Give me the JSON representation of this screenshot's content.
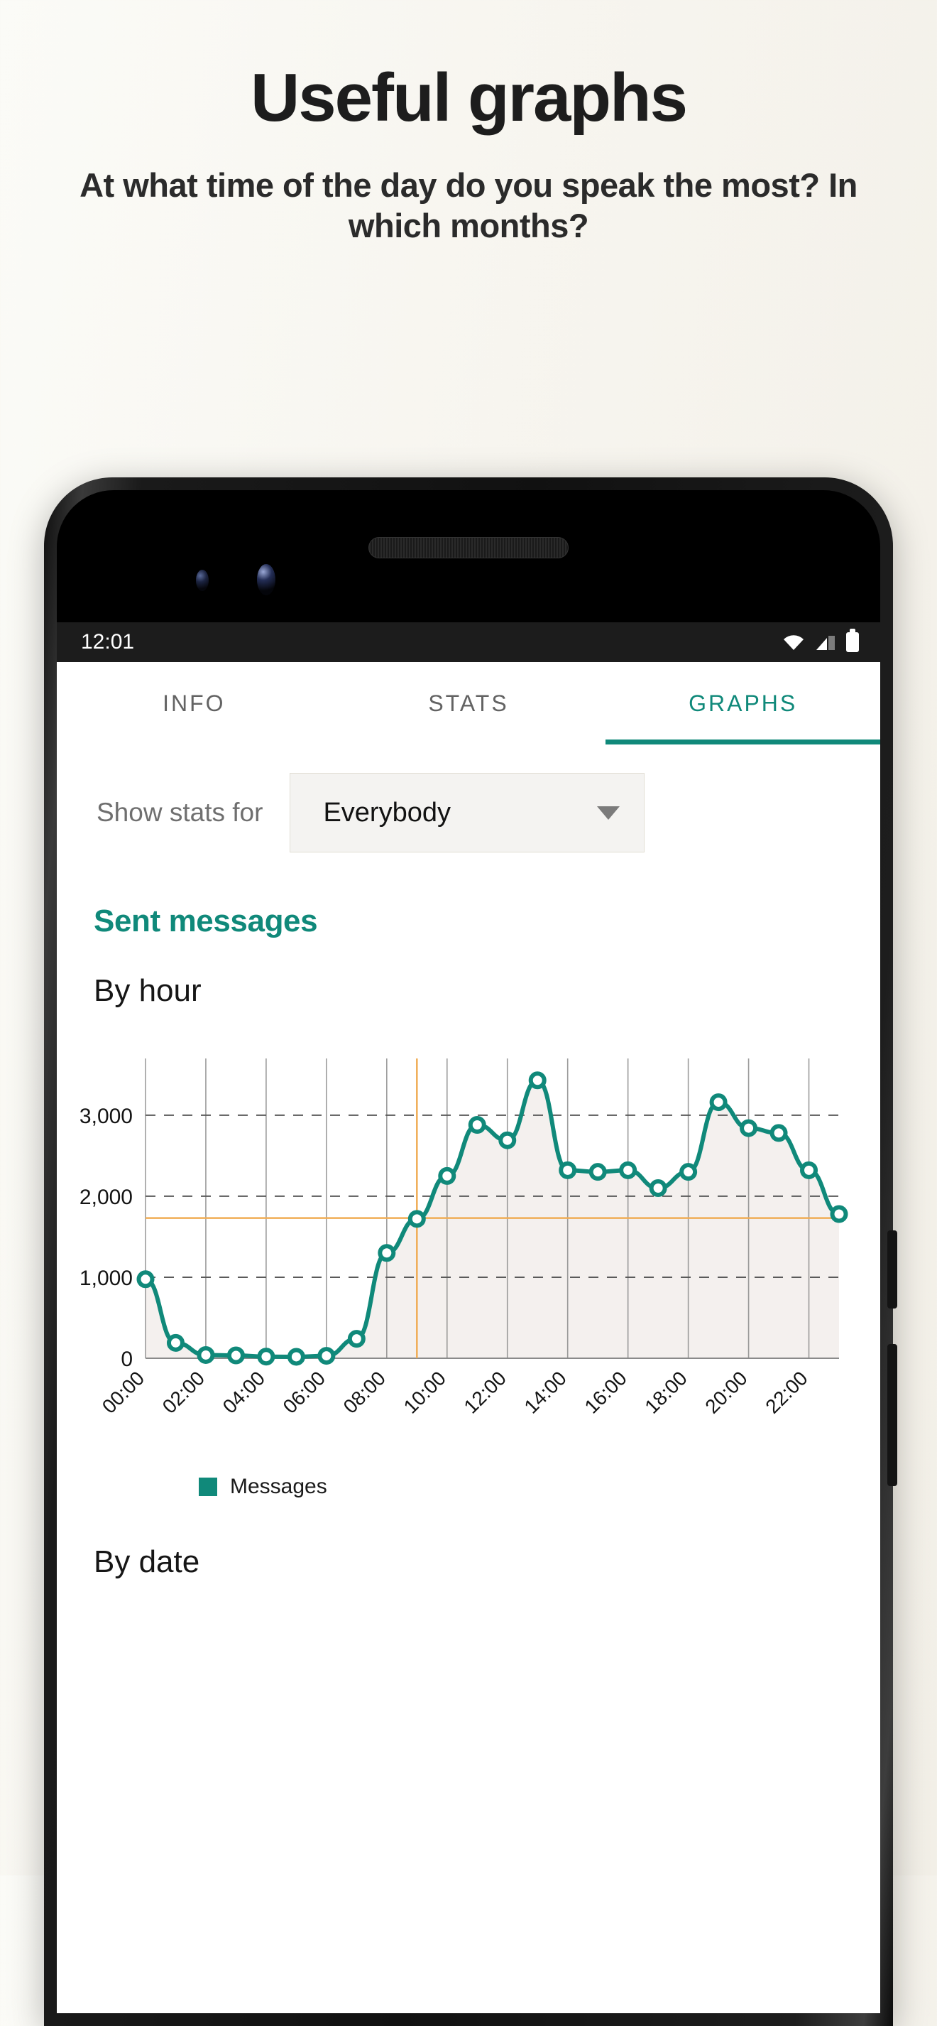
{
  "promo": {
    "title": "Useful graphs",
    "subtitle": "At what time of the day do you speak the most? In which months?"
  },
  "phone": {
    "status_bar": {
      "clock": "12:01",
      "icons": [
        "wifi-icon",
        "signal-icon",
        "battery-icon"
      ]
    }
  },
  "app": {
    "tabs": [
      {
        "label": "INFO",
        "active": false
      },
      {
        "label": "STATS",
        "active": false
      },
      {
        "label": "GRAPHS",
        "active": true
      }
    ],
    "filter": {
      "label": "Show stats for",
      "value": "Everybody",
      "caret": "chevron-down-icon"
    },
    "section_title": "Sent messages",
    "subsection_title": "By hour",
    "next_subsection_title": "By date",
    "legend": {
      "swatch_color": "#10897a",
      "label": "Messages"
    }
  },
  "colors": {
    "accent_teal": "#10897a",
    "marker_line": "#f0ad55",
    "grid": "#8a8a8a",
    "area_fill": "#f4f0ee"
  },
  "chart_data": {
    "type": "line",
    "title": "By hour",
    "xlabel": "",
    "ylabel": "",
    "grid": true,
    "legend": [
      "Messages"
    ],
    "legend_position": "bottom-left",
    "xlim": [
      0,
      23
    ],
    "ylim": [
      0,
      3700
    ],
    "yticks": [
      0,
      1000,
      2000,
      3000
    ],
    "ytick_labels": [
      "0",
      "1,000",
      "2,000",
      "3,000"
    ],
    "xticks": [
      "00:00",
      "02:00",
      "04:00",
      "06:00",
      "08:00",
      "10:00",
      "12:00",
      "14:00",
      "16:00",
      "18:00",
      "20:00",
      "22:00"
    ],
    "x": [
      "00:00",
      "01:00",
      "02:00",
      "03:00",
      "04:00",
      "05:00",
      "06:00",
      "07:00",
      "08:00",
      "09:00",
      "10:00",
      "11:00",
      "12:00",
      "13:00",
      "14:00",
      "15:00",
      "16:00",
      "17:00",
      "18:00",
      "19:00",
      "20:00",
      "21:00",
      "22:00",
      "23:00"
    ],
    "series": [
      {
        "name": "Messages",
        "color": "#10897a",
        "values": [
          975,
          190,
          40,
          35,
          20,
          18,
          30,
          240,
          1300,
          1720,
          2250,
          2880,
          2690,
          3430,
          2320,
          2300,
          2320,
          2100,
          2300,
          3160,
          2840,
          2780,
          2320,
          1780
        ]
      }
    ],
    "annotations": {
      "horizontal_marker": 1730,
      "vertical_marker": "09:00",
      "marker_color": "#f0ad55"
    }
  }
}
